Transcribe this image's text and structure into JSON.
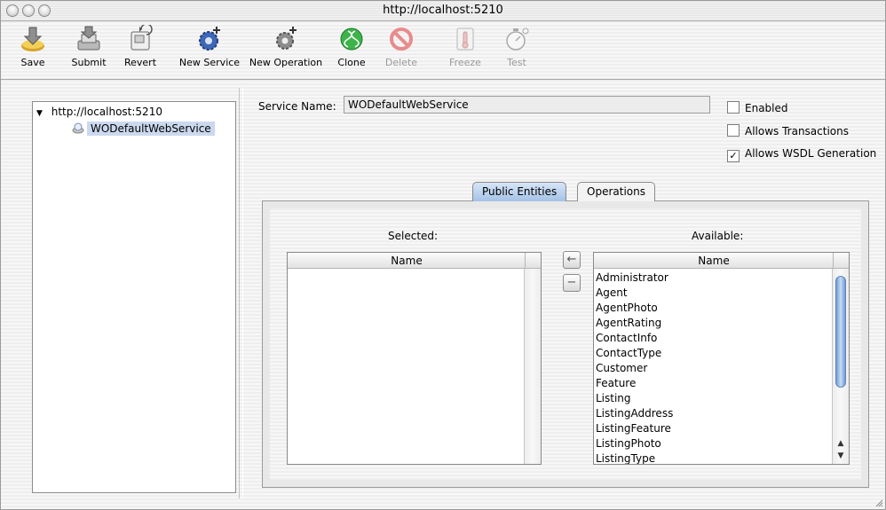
{
  "window": {
    "title": "http://localhost:5210"
  },
  "toolbar": {
    "items": [
      {
        "label": "Save",
        "icon": "save-icon",
        "enabled": true
      },
      {
        "label": "Submit",
        "icon": "submit-icon",
        "enabled": true
      },
      {
        "label": "Revert",
        "icon": "revert-icon",
        "enabled": true
      },
      {
        "label": "New Service",
        "icon": "new-service-icon",
        "enabled": true
      },
      {
        "label": "New Operation",
        "icon": "new-operation-icon",
        "enabled": true
      },
      {
        "label": "Clone",
        "icon": "clone-icon",
        "enabled": true
      },
      {
        "label": "Delete",
        "icon": "delete-icon",
        "enabled": false
      },
      {
        "label": "Freeze",
        "icon": "freeze-icon",
        "enabled": false
      },
      {
        "label": "Test",
        "icon": "test-icon",
        "enabled": false
      }
    ]
  },
  "tree": {
    "root": "http://localhost:5210",
    "child": "WODefaultWebService"
  },
  "service": {
    "name_label": "Service Name:",
    "name_value": "WODefaultWebService"
  },
  "options": {
    "enabled": {
      "label": "Enabled",
      "checked": false
    },
    "allows_transactions": {
      "label": "Allows Transactions",
      "checked": false
    },
    "allows_wsdl": {
      "label": "Allows WSDL Generation",
      "checked": true
    }
  },
  "tabs": [
    {
      "label": "Public Entities",
      "selected": true
    },
    {
      "label": "Operations",
      "selected": false
    }
  ],
  "selected_table": {
    "caption": "Selected:",
    "column": "Name",
    "rows": []
  },
  "available_table": {
    "caption": "Available:",
    "column": "Name",
    "rows": [
      "Administrator",
      "Agent",
      "AgentPhoto",
      "AgentRating",
      "ContactInfo",
      "ContactType",
      "Customer",
      "Feature",
      "Listing",
      "ListingAddress",
      "ListingFeature",
      "ListingPhoto",
      "ListingType"
    ]
  },
  "move_buttons": {
    "add": "←",
    "remove": "−"
  },
  "colors": {
    "selection": "#cbd9ee",
    "tab_selected": "#a4c2e6",
    "scroll_thumb": "#6f9bd3"
  }
}
